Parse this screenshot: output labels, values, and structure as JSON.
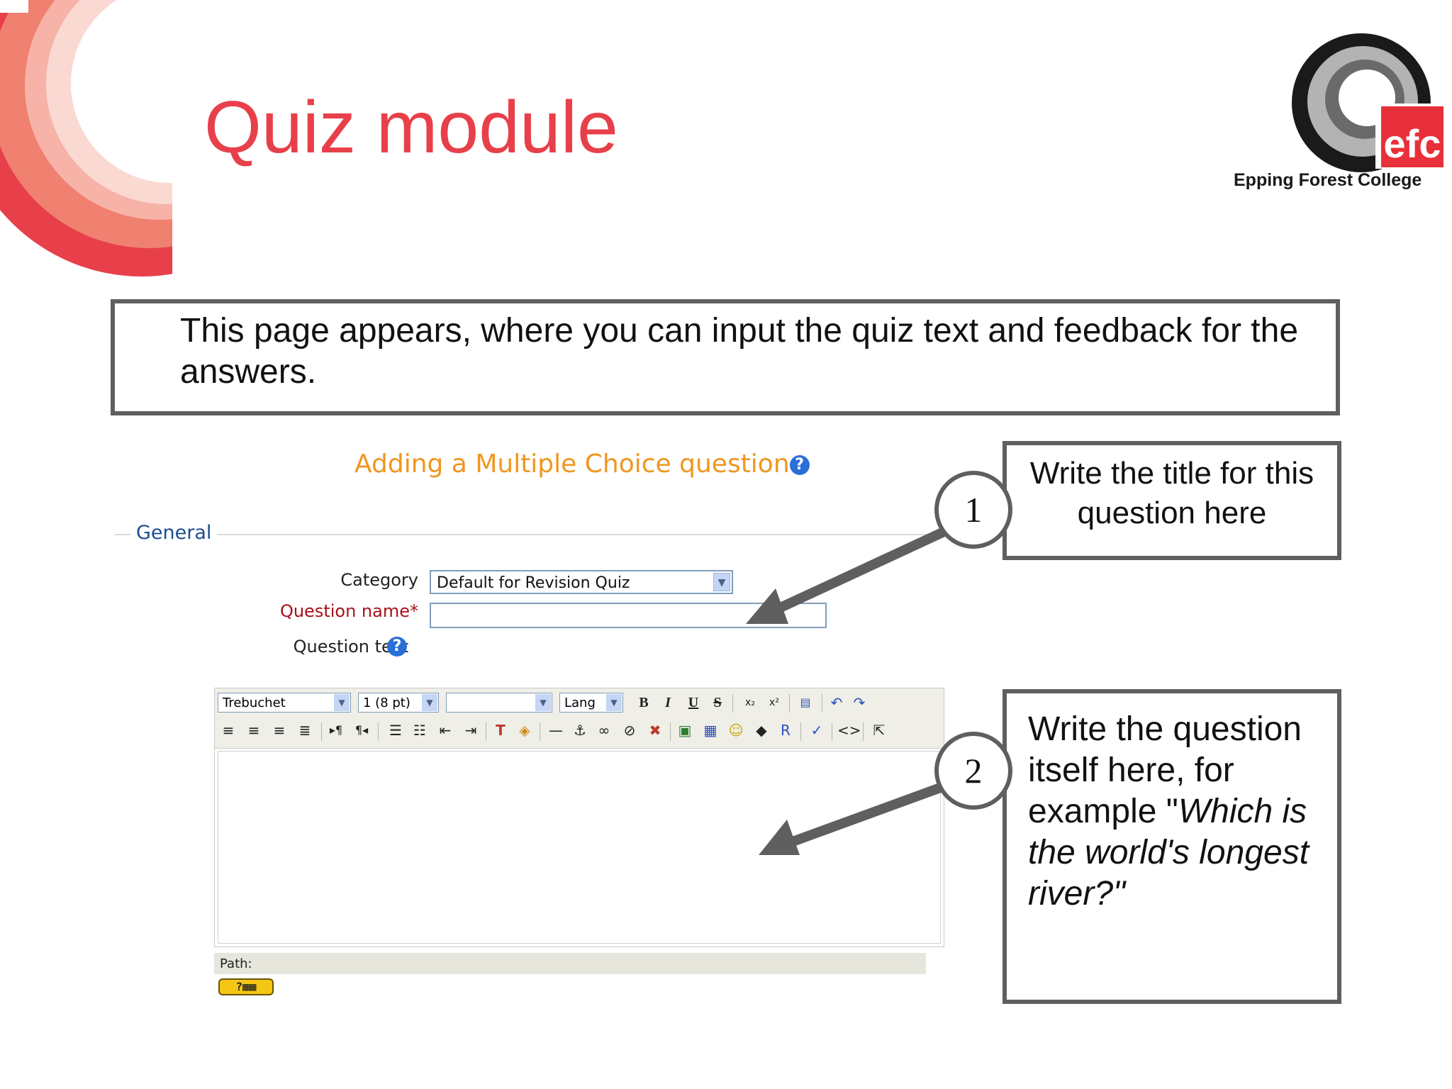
{
  "slide": {
    "title": "Quiz module",
    "college_name": "Epping Forest College",
    "logo_text": "efc",
    "intro_text": "This page appears, where you can input the quiz text and feedback for the answers."
  },
  "callouts": {
    "step1_number": "1",
    "step1_text": "Write the title for this question here",
    "step2_number": "2",
    "step2_text_plain": "Write the question itself here, for example \"",
    "step2_text_italic": "Which is the world's longest river?\""
  },
  "form": {
    "heading": "Adding a Multiple Choice question",
    "legend": "General",
    "category_label": "Category",
    "category_value": "Default for Revision Quiz",
    "question_name_label": "Question name*",
    "question_name_value": "",
    "question_text_label": "Question text"
  },
  "editor": {
    "font_value": "Trebuchet",
    "size_value": "1 (8 pt)",
    "format_value": "",
    "lang_value": "Lang",
    "path_label": "Path:",
    "bold_label": "B",
    "italic_label": "I",
    "underline_label": "U",
    "strike_label": "S"
  },
  "colors": {
    "title_red": "#e8404a",
    "heading_orange": "#f0961e",
    "callout_border": "#5f5f5f",
    "required_red": "#a6111a",
    "legend_blue": "#1d4d8f"
  }
}
